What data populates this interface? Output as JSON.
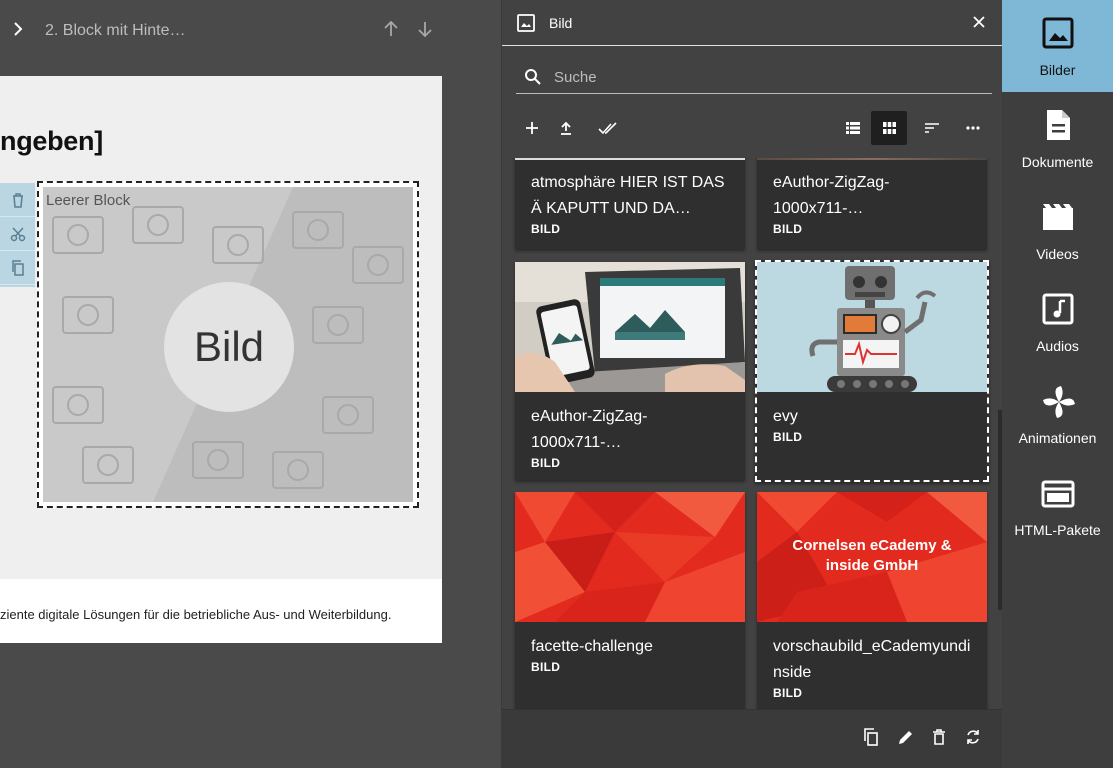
{
  "editor": {
    "block_title": "2. Block mit Hinte…",
    "heading": "ngeben]",
    "image_block_label": "Leerer Block",
    "image_placeholder_text": "Bild",
    "footer_text": "ziente digitale Lösungen für die betriebliche Aus- und Weiterbildung.",
    "tools": [
      "delete-icon",
      "cut-icon",
      "copy-icon"
    ]
  },
  "panel": {
    "title": "Bild",
    "search": {
      "placeholder": "Suche",
      "value": ""
    },
    "toolbar": {
      "left": [
        "add-icon",
        "upload-icon",
        "select-all-icon"
      ],
      "right": [
        "list-view-icon",
        "grid-view-icon",
        "sort-icon",
        "more-icon"
      ],
      "active_view": "grid"
    },
    "items": [
      {
        "name": "atmosphäre HIER IST DAS Ä KAPUTT UND DA…",
        "type": "BILD"
      },
      {
        "name": "eAuthor-ZigZag-1000x711-…",
        "type": "BILD"
      },
      {
        "name": "eAuthor-ZigZag-1000x711-…",
        "type": "BILD"
      },
      {
        "name": "evy",
        "type": "BILD",
        "selected": true
      },
      {
        "name": "facette-challenge",
        "type": "BILD"
      },
      {
        "name": "vorschaubild_eCademyundinside",
        "type": "BILD",
        "image_caption": "Cornelsen eCademy & inside GmbH"
      }
    ],
    "footer_actions": [
      "duplicate-icon",
      "edit-icon",
      "delete-icon",
      "refresh-icon"
    ]
  },
  "rail": {
    "items": [
      {
        "label": "Bilder",
        "icon": "image-icon",
        "active": true
      },
      {
        "label": "Dokumente",
        "icon": "document-icon",
        "active": false
      },
      {
        "label": "Videos",
        "icon": "video-icon",
        "active": false
      },
      {
        "label": "Audios",
        "icon": "audio-icon",
        "active": false
      },
      {
        "label": "Animationen",
        "icon": "animation-icon",
        "active": false
      },
      {
        "label": "HTML-Pakete",
        "icon": "html-package-icon",
        "active": false
      }
    ]
  },
  "colors": {
    "rail_active": "#7eb8d6",
    "panel_bg": "#424242",
    "card_bg": "#2f2f2f",
    "promo_red": "#e3201b"
  }
}
